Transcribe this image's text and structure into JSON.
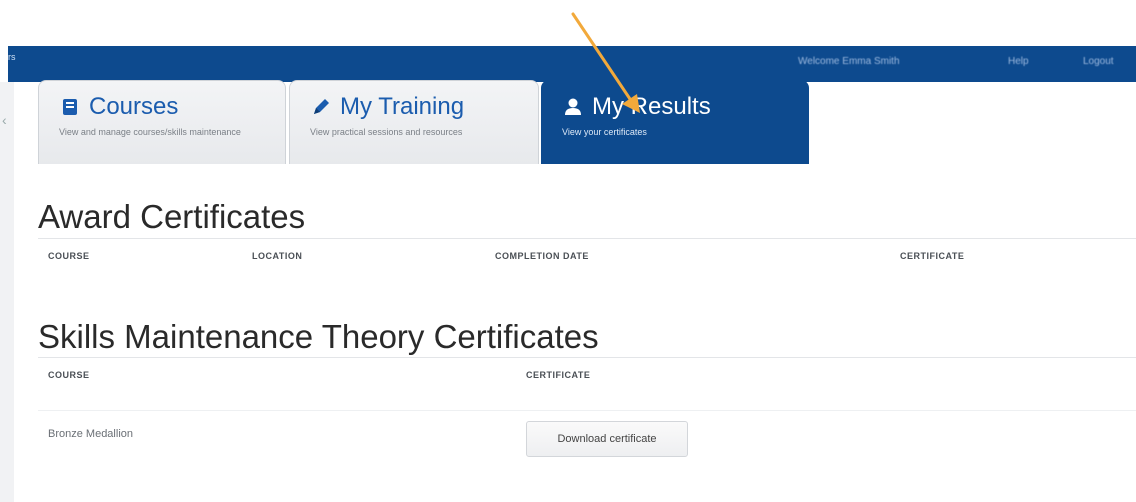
{
  "header": {
    "left_mark": "rs",
    "right_items": [
      "Welcome Emma Smith",
      "Help",
      "Logout"
    ]
  },
  "tabs": [
    {
      "title": "Courses",
      "desc": "View and manage courses/skills maintenance",
      "icon": "book-icon",
      "active": false
    },
    {
      "title": "My Training",
      "desc": "View practical sessions and resources",
      "icon": "pencil-icon",
      "active": false
    },
    {
      "title": "My Results",
      "desc": "View your certificates",
      "icon": "user-icon",
      "active": true
    }
  ],
  "award": {
    "title": "Award Certificates",
    "columns": [
      "COURSE",
      "LOCATION",
      "COMPLETION DATE",
      "CERTIFICATE"
    ]
  },
  "skills": {
    "title": "Skills Maintenance Theory Certificates",
    "columns": [
      "COURSE",
      "CERTIFICATE"
    ],
    "rows": [
      {
        "course": "Bronze Medallion",
        "action": "Download certificate"
      }
    ]
  },
  "colors": {
    "brand": "#0d4a8e",
    "annotation_arrow": "#f2a93b"
  }
}
